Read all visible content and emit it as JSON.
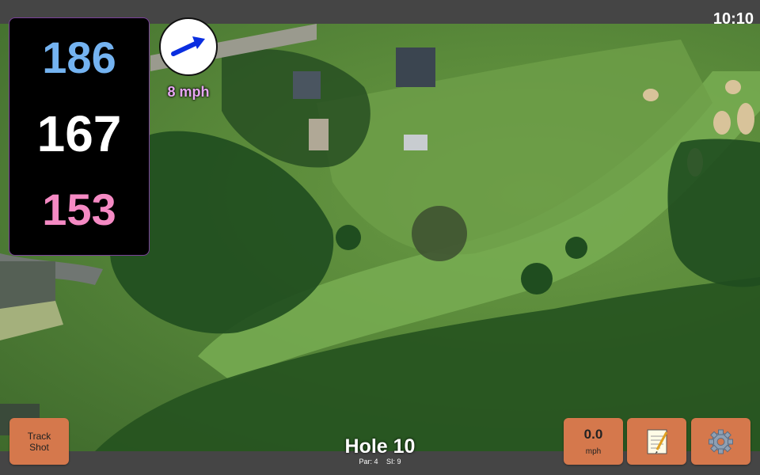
{
  "status": {
    "time": "10:10"
  },
  "distances": {
    "back": "186",
    "center": "167",
    "front": "153"
  },
  "wind": {
    "speed": "8 mph",
    "icon": "wind-arrow-icon"
  },
  "hole": {
    "title": "Hole 10",
    "par": "Par: 4",
    "stroke_index": "SI: 9"
  },
  "buttons": {
    "track_shot": {
      "line1": "Track",
      "line2": "Shot"
    },
    "speed": {
      "value": "0.0",
      "unit": "mph"
    },
    "notes": {
      "icon": "notepad-icon"
    },
    "settings": {
      "icon": "gear-icon"
    }
  },
  "colors": {
    "back": "#74b3f1",
    "center": "#ffffff",
    "front": "#f58ac4",
    "button": "#d5784c",
    "wind_text": "#e7a6f2"
  }
}
